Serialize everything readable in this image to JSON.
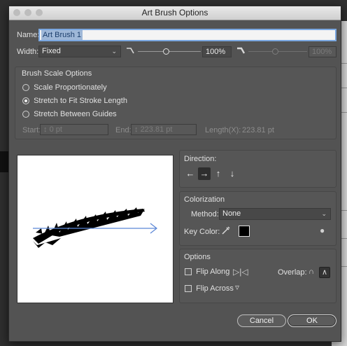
{
  "dialog": {
    "title": "Art Brush Options"
  },
  "name": {
    "label": "Name:",
    "value": "Art Brush 1"
  },
  "width": {
    "label": "Width:",
    "option": "Fixed",
    "value": "100%",
    "secondary_value": "100%"
  },
  "brush_scale": {
    "title": "Brush Scale Options",
    "options": [
      {
        "label": "Scale Proportionately",
        "selected": false
      },
      {
        "label": "Stretch to Fit Stroke Length",
        "selected": true
      },
      {
        "label": "Stretch Between Guides",
        "selected": false
      }
    ],
    "start_label": "Start:",
    "start_value": "0 pt",
    "end_label": "End:",
    "end_value": "223.81 pt",
    "length_label": "Length(X):",
    "length_value": "223.81 pt"
  },
  "direction": {
    "title": "Direction:",
    "arrows": [
      "←",
      "→",
      "↑",
      "↓"
    ],
    "active_index": 1
  },
  "colorization": {
    "title": "Colorization",
    "method_label": "Method:",
    "method_value": "None",
    "key_color_label": "Key Color:",
    "key_color": "#000000"
  },
  "options": {
    "title": "Options",
    "flip_along_label": "Flip Along",
    "flip_across_label": "Flip Across",
    "overlap_label": "Overlap:"
  },
  "buttons": {
    "cancel": "Cancel",
    "ok": "OK"
  },
  "icons": {
    "width_left": "thin-stroke-icon",
    "width_right": "thick-stroke-icon",
    "eyedropper": "eyedropper-icon",
    "tip": "lightbulb-icon"
  },
  "colors": {
    "accent": "#7aa7e0",
    "dialog_bg": "#535353",
    "arrow": "#5a86d6"
  }
}
